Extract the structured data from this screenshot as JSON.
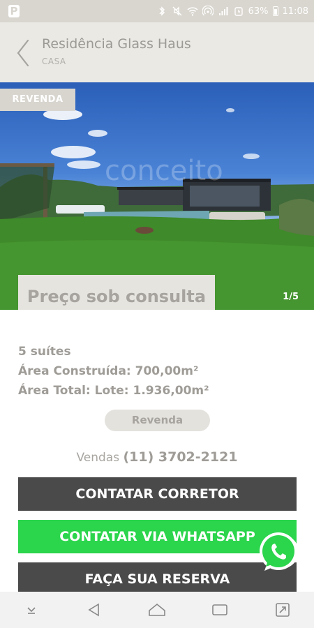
{
  "status_bar": {
    "battery": "63%",
    "time": "11:08",
    "icons": [
      "app-p-icon",
      "bluetooth-icon",
      "mute-icon",
      "wifi-icon",
      "hotspot-icon",
      "signal-icon",
      "alarm-icon",
      "battery-icon"
    ]
  },
  "header": {
    "title": "Residência Glass Haus",
    "subtitle": "CASA"
  },
  "listing": {
    "badge": "REVENDA",
    "price": "Preço sob consulta",
    "image_counter": "1/5",
    "watermark": "conceito",
    "details": [
      "5 suítes",
      "Área Construída: 700,00m²",
      "Área Total: Lote: 1.936,00m²"
    ],
    "status_pill": "Revenda",
    "phone_label": "Vendas",
    "phone_number": "(11) 3702-2121"
  },
  "actions": {
    "contact_broker": "CONTATAR CORRETOR",
    "contact_whatsapp": "CONTATAR VIA WHATSAPP",
    "reserve": "FAÇA SUA RESERVA"
  },
  "colors": {
    "accent_dark": "#4a4a4a",
    "whatsapp_green": "#2bd54c",
    "header_bg": "#ebe9e4",
    "muted_text": "#9f9c97"
  }
}
